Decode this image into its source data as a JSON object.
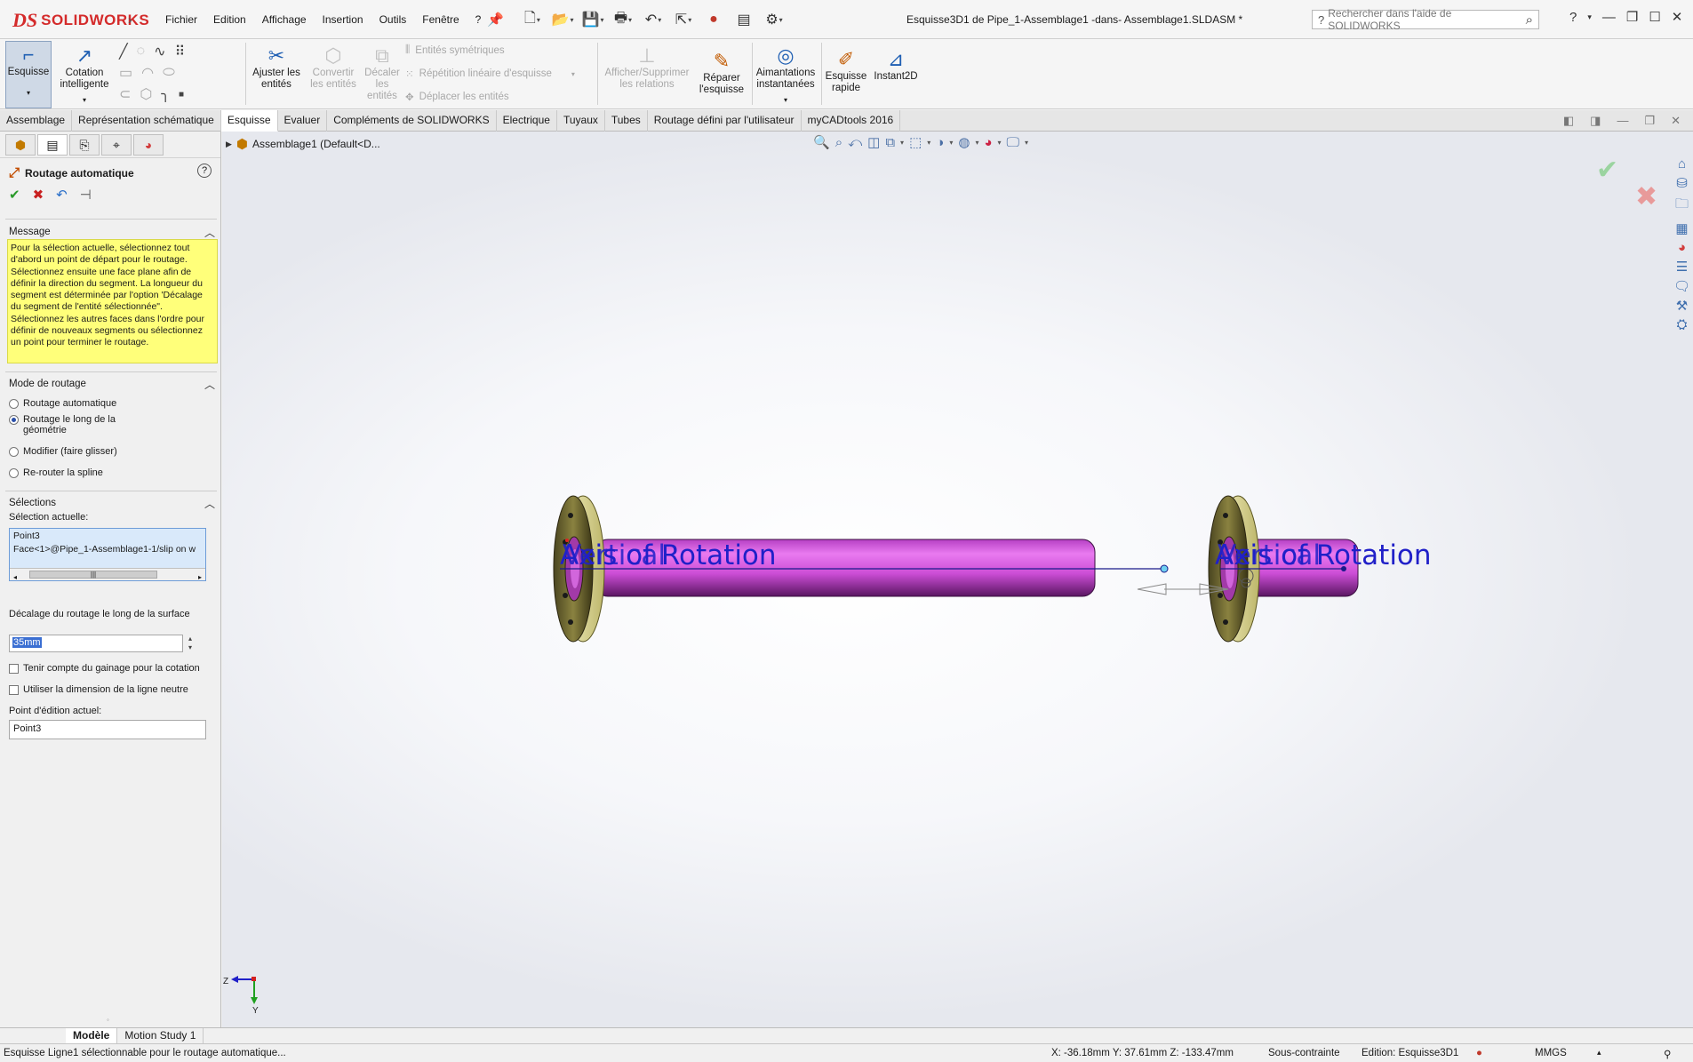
{
  "app": {
    "logo_ds": "DS",
    "logo_name": "SOLIDWORKS",
    "menus": [
      "Fichier",
      "Edition",
      "Affichage",
      "Insertion",
      "Outils",
      "Fenêtre",
      "?"
    ],
    "doc_title": "Esquisse3D1 de Pipe_1-Assemblage1 -dans- Assemblage1.SLDASM *",
    "search_placeholder": "Rechercher dans l'aide de SOLIDWORKS"
  },
  "command_manager": {
    "esquisse": "Esquisse",
    "cotation": "Cotation intelligente",
    "ajuster": "Ajuster les entités",
    "convertir": "Convertir les entités",
    "decaler": "Décaler les entités",
    "entites_sym": "Entités symétriques",
    "repetition": "Répétition linéaire d'esquisse",
    "deplacer": "Déplacer les entités",
    "afficher_rel": "Afficher/Supprimer les relations",
    "reparer": "Réparer l'esquisse",
    "aimantations": "Aimantations instantanées",
    "esquisse_rapide": "Esquisse rapide",
    "instant2d": "Instant2D"
  },
  "tabs": [
    {
      "label": "Assemblage",
      "active": false
    },
    {
      "label": "Représentation schématique",
      "active": false
    },
    {
      "label": "Esquisse",
      "active": true
    },
    {
      "label": "Evaluer",
      "active": false
    },
    {
      "label": "Compléments de SOLIDWORKS",
      "active": false
    },
    {
      "label": "Electrique",
      "active": false
    },
    {
      "label": "Tuyaux",
      "active": false
    },
    {
      "label": "Tubes",
      "active": false
    },
    {
      "label": "Routage défini par l'utilisateur",
      "active": false
    },
    {
      "label": "myCADtools 2016",
      "active": false
    }
  ],
  "property_manager": {
    "title": "Routage automatique",
    "message_header": "Message",
    "message": "Pour la sélection actuelle, sélectionnez tout d'abord un point de départ pour le routage. Sélectionnez ensuite une face plane afin de définir la direction du segment. La longueur du segment est déterminée par l'option 'Décalage du segment de l'entité sélectionnée\". Sélectionnez les autres faces dans l'ordre pour définir de nouveaux segments ou sélectionnez un point pour terminer le routage.",
    "mode_header": "Mode de routage",
    "modes": [
      {
        "label": "Routage automatique",
        "selected": false
      },
      {
        "label": "Routage le long de la géométrie",
        "selected": true
      },
      {
        "label": "Modifier (faire glisser)",
        "selected": false
      },
      {
        "label": "Re-router la spline",
        "selected": false
      }
    ],
    "selections_header": "Sélections",
    "current_selection_label": "Sélection actuelle:",
    "current_selection": [
      "Point3",
      "Face<1>@Pipe_1-Assemblage1-1/slip on w"
    ],
    "offset_label": "Décalage du routage le long de la surface",
    "offset_value": "35mm",
    "checkbox_sheath": "Tenir compte du gainage pour la cotation",
    "checkbox_neutral": "Utiliser la dimension de la ligne neutre",
    "edit_point_label": "Point d'édition actuel:",
    "edit_point_value": "Point3"
  },
  "graphics": {
    "tree_root": "Assemblage1  (Default<D...",
    "annotation_left": "Vertical",
    "annotation_left_overlap": "Axis of Rotation",
    "annotation_right": "Vertical",
    "annotation_right_overlap": "Axis of Rotation",
    "pipe_color": "#d04fd8",
    "flange_color": "#e8e49a",
    "triad_z": "Z",
    "triad_y": "Y"
  },
  "bottom_tabs": [
    {
      "label": "Modèle",
      "active": true
    },
    {
      "label": "Motion Study 1",
      "active": false
    }
  ],
  "status": {
    "message": "Esquisse Ligne1 sélectionnable pour le routage automatique...",
    "coords": "X: -36.18mm Y: 37.61mm Z: -133.47mm",
    "constraint": "Sous-contrainte",
    "editing": "Edition: Esquisse3D1",
    "units": "MMGS"
  }
}
